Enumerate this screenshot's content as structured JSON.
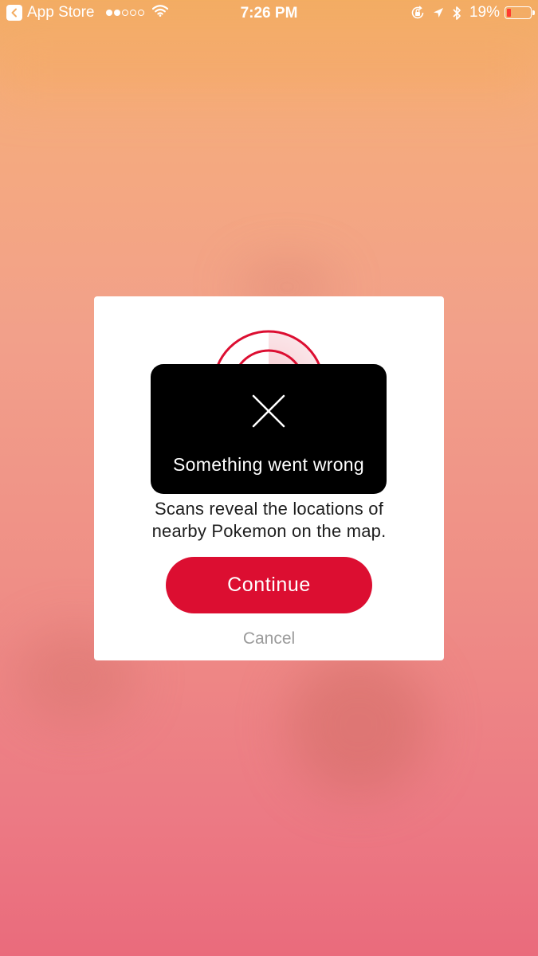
{
  "status_bar": {
    "back_app": "App Store",
    "time": "7:26 PM",
    "battery_percent": "19%",
    "signal_bars_filled": 2,
    "signal_bars_total": 5,
    "battery_level": 0.19,
    "battery_color": "#ff3b30"
  },
  "modal": {
    "description": "Scans reveal the locations of nearby Pokemon on the map.",
    "continue_label": "Continue",
    "cancel_label": "Cancel",
    "accent_color": "#dc0e31"
  },
  "toast": {
    "message": "Something went wrong",
    "icon": "close-icon"
  }
}
